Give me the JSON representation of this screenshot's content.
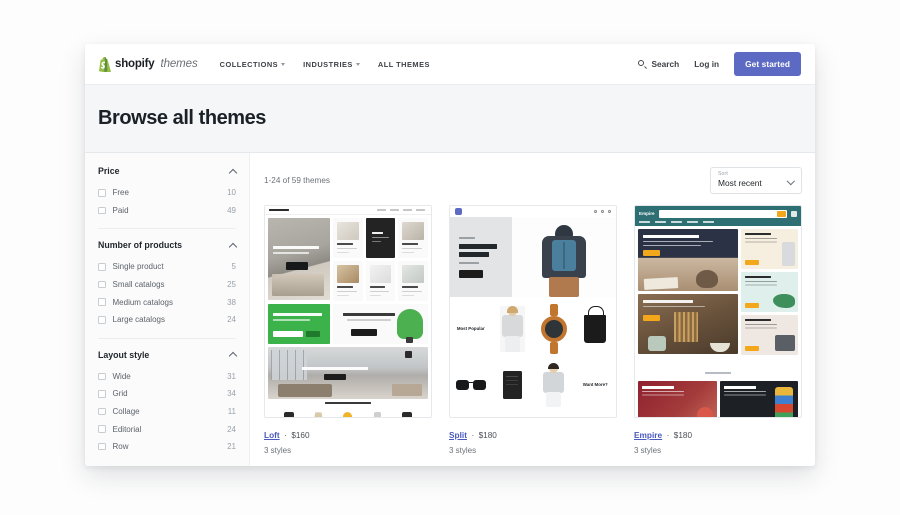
{
  "nav": {
    "brand_name": "shopify",
    "brand_suffix": "themes",
    "links": [
      {
        "label": "COLLECTIONS",
        "has_caret": true
      },
      {
        "label": "INDUSTRIES",
        "has_caret": true
      },
      {
        "label": "ALL THEMES",
        "has_caret": false
      }
    ],
    "search_label": "Search",
    "login_label": "Log in",
    "cta_label": "Get started",
    "cta_color": "#5c6ac4",
    "brand_color": "#95bf47"
  },
  "page": {
    "title": "Browse all themes"
  },
  "filters": [
    {
      "title": "Price",
      "options": [
        {
          "label": "Free",
          "count": "10"
        },
        {
          "label": "Paid",
          "count": "49"
        }
      ]
    },
    {
      "title": "Number of products",
      "options": [
        {
          "label": "Single product",
          "count": "5"
        },
        {
          "label": "Small catalogs",
          "count": "25"
        },
        {
          "label": "Medium catalogs",
          "count": "38"
        },
        {
          "label": "Large catalogs",
          "count": "24"
        }
      ]
    },
    {
      "title": "Layout style",
      "options": [
        {
          "label": "Wide",
          "count": "31"
        },
        {
          "label": "Grid",
          "count": "34"
        },
        {
          "label": "Collage",
          "count": "11"
        },
        {
          "label": "Editorial",
          "count": "24"
        },
        {
          "label": "Row",
          "count": "21"
        }
      ]
    }
  ],
  "results": {
    "count_text": "1-24 of 59 themes",
    "sort_label": "Sort",
    "sort_value": "Most recent"
  },
  "themes": [
    {
      "name": "Loft",
      "separator": "·",
      "price": "$160",
      "styles": "3 styles",
      "preview": {
        "headline": "Timeless Modern Furniture Store",
        "promo": "Invite people to join your list",
        "sale_heading": "Lounge Furniture Sales",
        "feature_caption": "Feature image with search or call to action",
        "footer_heading": "Featured Lighting",
        "tiles": [
          "Accessories",
          "Decorative Objects",
          "Furniture",
          "Lighting",
          "Living Room Furniture"
        ]
      }
    },
    {
      "name": "Split",
      "separator": "·",
      "price": "$180",
      "styles": "3 styles",
      "preview": {
        "kicker": "New Arrival",
        "headline_line1": "Unisex",
        "headline_line2": "Backpack",
        "price_note": "$129.00",
        "button": "Shop now",
        "label_left": "Most Popular",
        "label_right": "Want More?"
      }
    },
    {
      "name": "Empire",
      "separator": "·",
      "price": "$180",
      "styles": "3 styles",
      "preview": {
        "brand": "Empire",
        "hero_heading": "Showcase Promotions",
        "hero2_heading": "Improve Discoverability",
        "side_blocks": [
          "Expedite Checkout",
          "Highlight Discounts",
          "Build Social Proof"
        ],
        "bottom_blocks": [
          "Our Best Sellers",
          "Deal of the Day"
        ],
        "section_label": "Promotions",
        "button_label": "Shop Now",
        "header_color": "#2e6f74",
        "accent_color": "#f3a81c"
      }
    }
  ]
}
